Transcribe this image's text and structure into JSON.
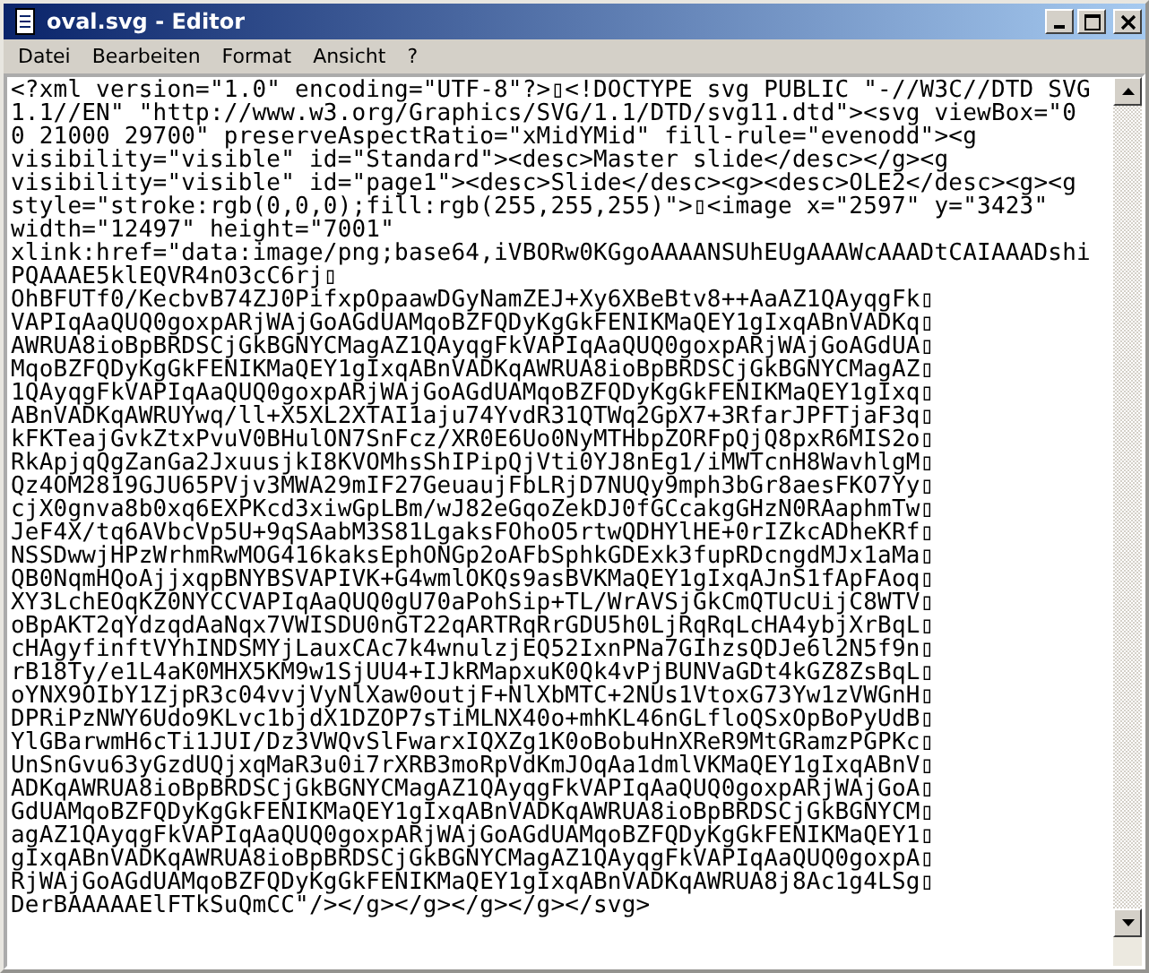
{
  "window": {
    "title": "oval.svg - Editor"
  },
  "menu": [
    "Datei",
    "Bearbeiten",
    "Format",
    "Ansicht",
    "?"
  ],
  "editor": {
    "lines": [
      "<?xml version=\"1.0\" encoding=\"UTF-8\"?>▯<!DOCTYPE svg PUBLIC \"-//W3C//DTD SVG",
      "1.1//EN\" \"http://www.w3.org/Graphics/SVG/1.1/DTD/svg11.dtd\"><svg viewBox=\"0",
      "0 21000 29700\" preserveAspectRatio=\"xMidYMid\" fill-rule=\"evenodd\"><g",
      "visibility=\"visible\" id=\"Standard\"><desc>Master slide</desc></g><g",
      "visibility=\"visible\" id=\"page1\"><desc>Slide</desc><g><desc>OLE2</desc><g><g",
      "style=\"stroke:rgb(0,0,0);fill:rgb(255,255,255)\">▯<image x=\"2597\" y=\"3423\"",
      "width=\"12497\" height=\"7001\"",
      "xlink:href=\"data:image/png;base64,iVBORw0KGgoAAAANSUhEUgAAAWcAAADtCAIAAADshi",
      "PQAAAE5klEQVR4nO3cC6rj▯",
      "OhBFUTf0/KecbvB74ZJ0PifxpOpaawDGyNamZEJ+Xy6XBeBtv8++AaAZ1QAyqgFk▯",
      "VAPIqAaQUQ0goxpARjWAjGoAGdUAMqoBZFQDyKgGkFENIKMaQEY1gIxqABnVADKq▯",
      "AWRUA8ioBpBRDSCjGkBGNYCMagAZ1QAyqgFkVAPIqAaQUQ0goxpARjWAjGoAGdUA▯",
      "MqoBZFQDyKgGkFENIKMaQEY1gIxqABnVADKqAWRUA8ioBpBRDSCjGkBGNYCMagAZ▯",
      "1QAyqgFkVAPIqAaQUQ0goxpARjWAjGoAGdUAMqoBZFQDyKgGkFENIKMaQEY1gIxq▯",
      "ABnVADKqAWRUYwq/ll+X5XL2XTAI1aju74YvdR31QTWq2GpX7+3RfarJPFTjaF3q▯",
      "kFKTeajGvkZtxPvuV0BHulON7SnFcz/XR0E6Uo0NyMTHbpZORFpQjQ8pxR6MIS2o▯",
      "RkApjqQgZanGa2JxuusjkI8KVOMhsShIPipQjVti0YJ8nEg1/iMWTcnH8WavhlgM▯",
      "Qz4OM2819GJU65PVjv3MWA29mIF27GeuaujFbLRjD7NUQy9mph3bGr8aesFKO7Yy▯",
      "cjX0gnva8b0xq6EXPKcd3xiwGpLBm/wJ82eGqoZekDJ0fGCcakgGHzN0RAaphmTw▯",
      "JeF4X/tq6AVbcVp5U+9qSAabM3S81LgaksFOhoO5rtwQDHYlHE+0rIZkcADheKRf▯",
      "NSSDwwjHPzWrhmRwMOG416kaksEphONGp2oAFbSphkGDExk3fupRDcngdMJx1aMa▯",
      "QB0NqmHQoAjjxqpBNYBSVAPIVK+G4wmlOKQs9asBVKMaQEY1gIxqAJnS1fApFAoq▯",
      "XY3LchEOqKZ0NYCCVAPIqAaQUQ0gU70aPohSip+TL/WrAVSjGkCmQTUcUijC8WTV▯",
      "oBpAKT2qYdzqdAaNqx7VWISDU0nGT22qARTRqRrGDU5h0LjRqRqLcHA4ybjXrBqL▯",
      "cHAgyfinftVYhINDSMYjLauxCAc7k4wnulzjEQ52IxnPNa7GIhzsQDJe6l2N5f9n▯",
      "rB18Ty/e1L4aK0MHX5KM9w1SjUU4+IJkRMapxuK0Qk4vPjBUNVaGDt4kGZ8ZsBqL▯",
      "oYNX9OIbY1ZjpR3c04vvjVyNlXaw0outjF+NlXbMTC+2NUs1VtoxG73Yw1zVWGnH▯",
      "DPRiPzNWY6Udo9KLvc1bjdX1DZOP7sTiMLNX40o+mhKL46nGLfloQSxOpBoPyUdB▯",
      "YlGBarwmH6cTi1JUI/Dz3VWQvSlFwarxIQXZg1K0oBobuHnXReR9MtGRamzPGPKc▯",
      "UnSnGvu63yGzdUQjxqMaR3u0i7rXRB3moRpVdKmJOqAa1dmlVKMaQEY1gIxqABnV▯",
      "ADKqAWRUA8ioBpBRDSCjGkBGNYCMagAZ1QAyqgFkVAPIqAaQUQ0goxpARjWAjGoA▯",
      "GdUAMqoBZFQDyKgGkFENIKMaQEY1gIxqABnVADKqAWRUA8ioBpBRDSCjGkBGNYCM▯",
      "agAZ1QAyqgFkVAPIqAaQUQ0goxpARjWAjGoAGdUAMqoBZFQDyKgGkFENIKMaQEY1▯",
      "gIxqABnVADKqAWRUA8ioBpBRDSCjGkBGNYCMagAZ1QAyqgFkVAPIqAaQUQ0goxpA▯",
      "RjWAjGoAGdUAMqoBZFQDyKgGkFENIKMaQEY1gIxqABnVADKqAWRUA8j8Ac1g4LSg▯",
      "DerBAAAAAElFTkSuQmCC\"/></g></g></g></g></svg>"
    ]
  }
}
